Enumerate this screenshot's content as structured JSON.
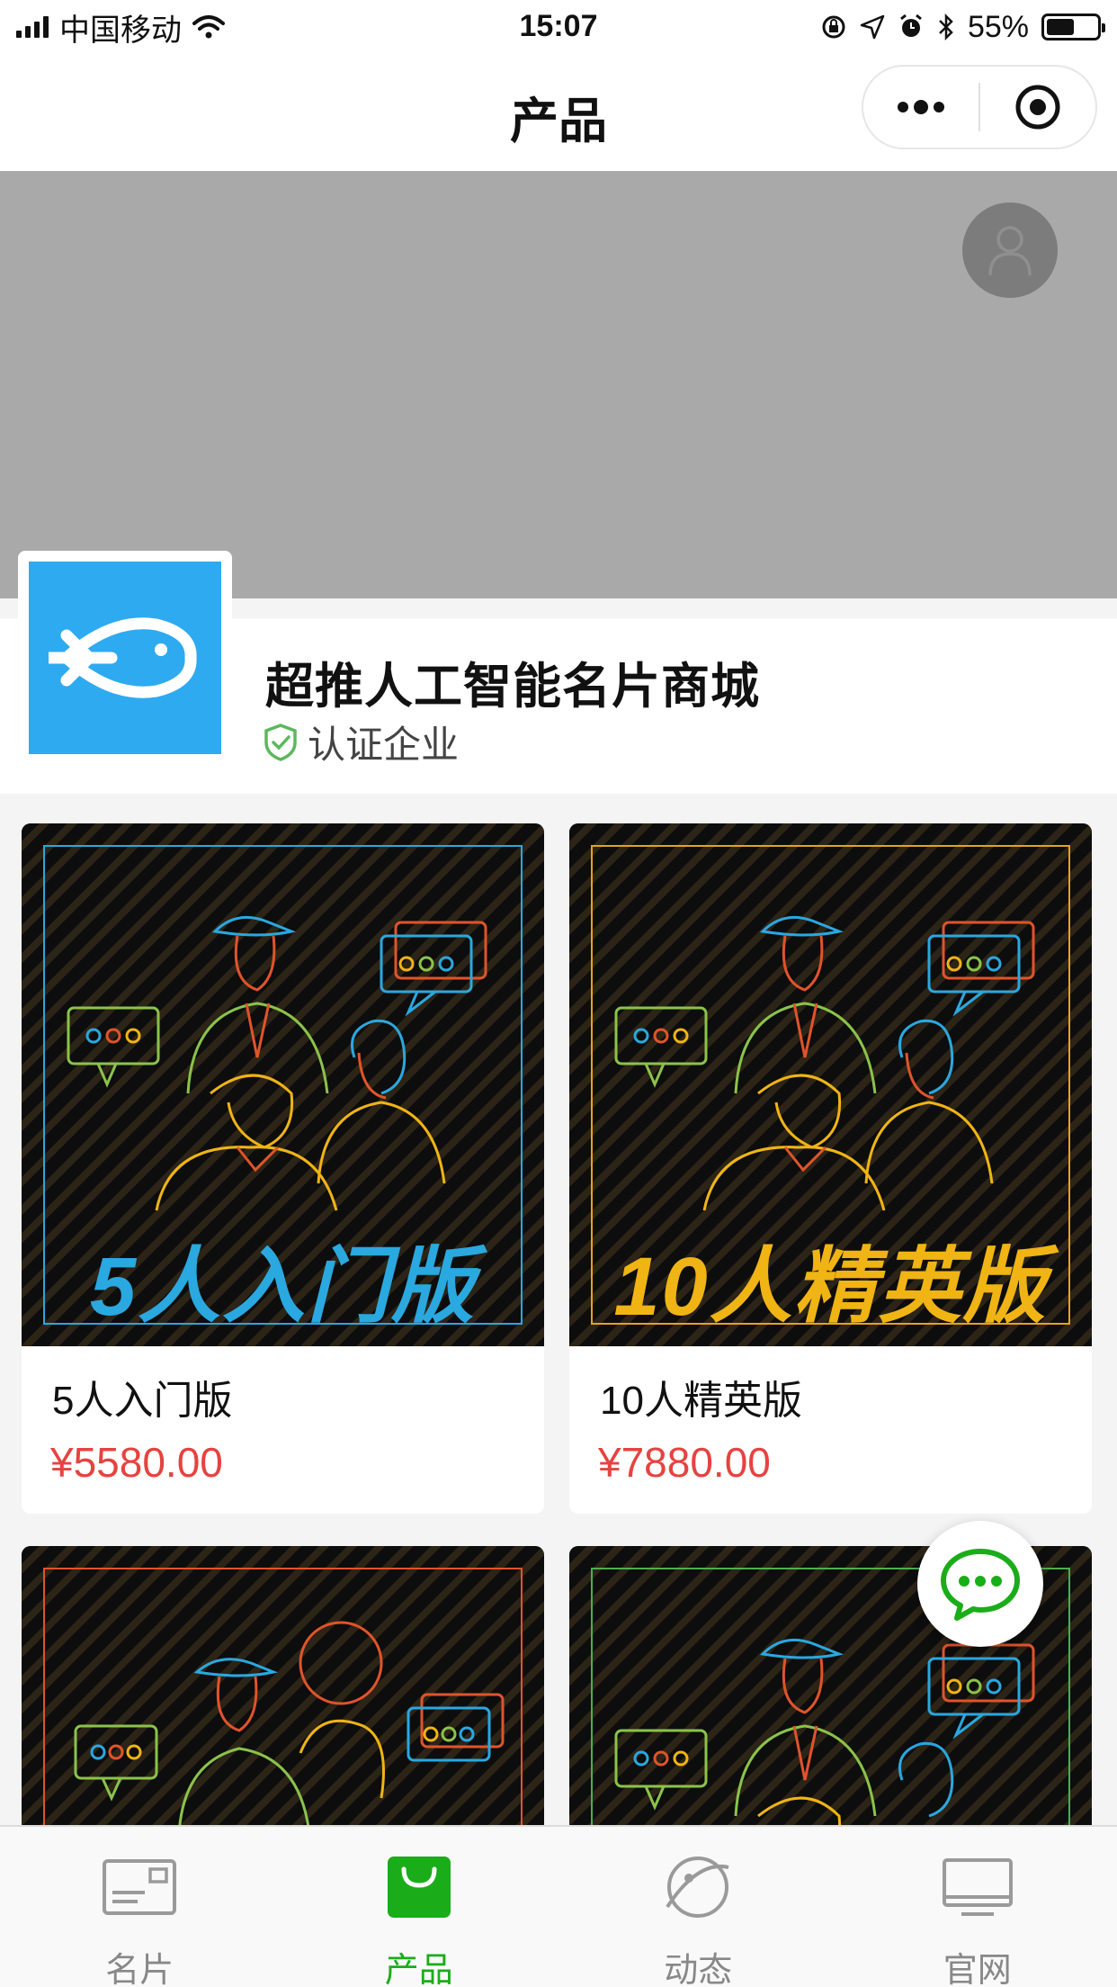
{
  "status_bar": {
    "carrier": "中国移动",
    "time": "15:07",
    "battery": "55%",
    "battery_level": 0.55
  },
  "nav": {
    "title": "产品"
  },
  "company": {
    "name": "超推人工智能名片商城",
    "verified_label": "认证企业"
  },
  "products": [
    {
      "name": "5人入门版",
      "price": "¥5580.00",
      "banner": "5人入门版",
      "accent": "#2aa8e0",
      "banner_color": "#2aa8e0"
    },
    {
      "name": "10人精英版",
      "price": "¥7880.00",
      "banner": "10人精英版",
      "accent": "#e3a51b",
      "banner_color": "#f0b414"
    },
    {
      "accent": "#e0542a"
    },
    {
      "accent": "#4caf50"
    }
  ],
  "tabs": [
    {
      "label": "名片",
      "icon": "card-icon",
      "active": false
    },
    {
      "label": "产品",
      "icon": "bag-icon",
      "active": true
    },
    {
      "label": "动态",
      "icon": "planet-icon",
      "active": false
    },
    {
      "label": "官网",
      "icon": "monitor-icon",
      "active": false
    }
  ],
  "colors": {
    "tab_active": "#1aad19",
    "price": "#e64340",
    "logo_bg": "#2eaaf0"
  }
}
